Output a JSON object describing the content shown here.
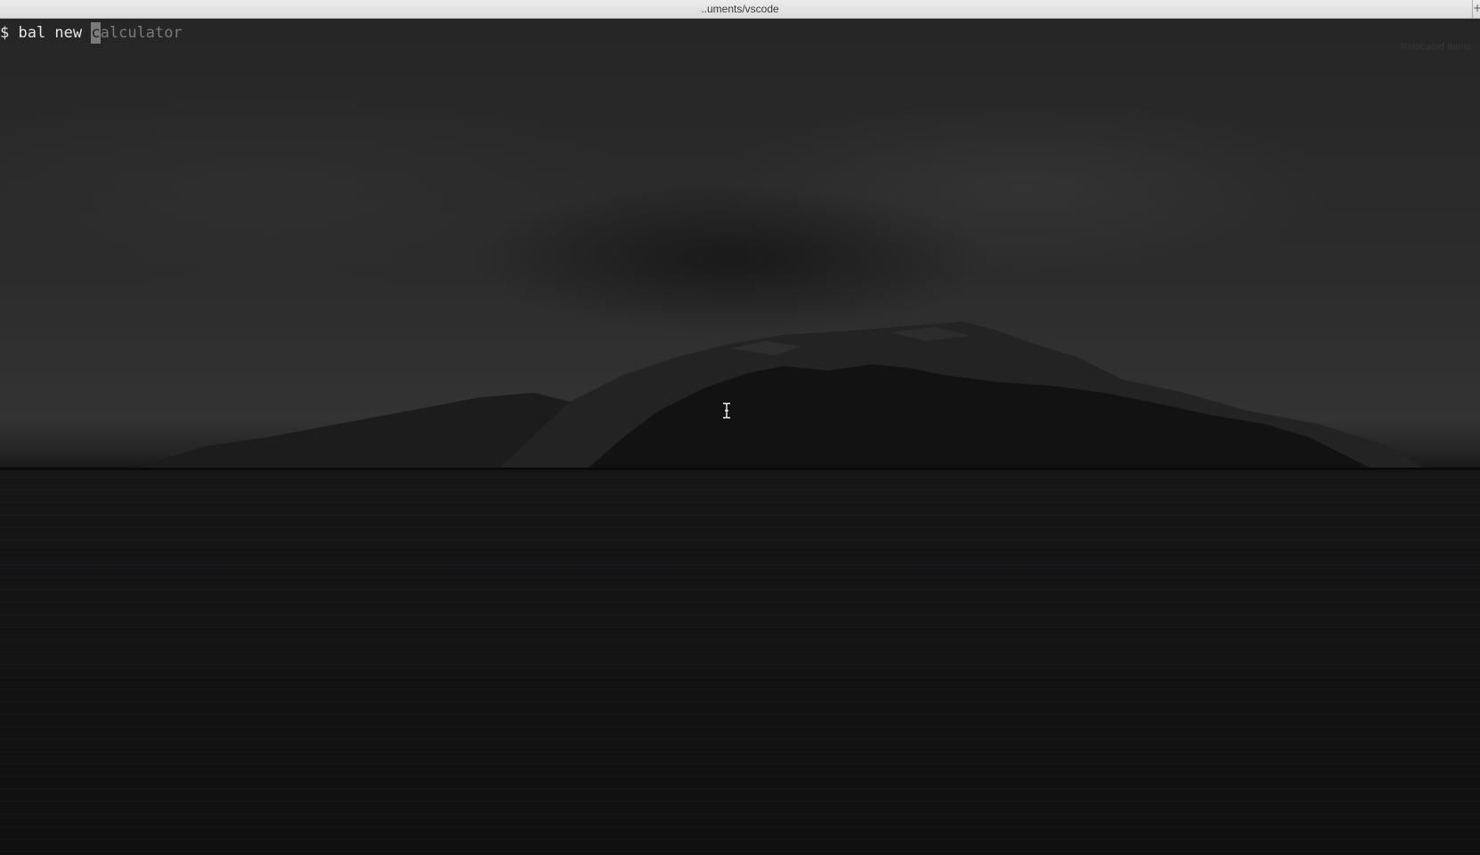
{
  "window": {
    "title": "..uments/vscode",
    "new_tab_glyph": "+"
  },
  "terminal": {
    "prompt": "$ ",
    "typed_text": "bal new ",
    "cursor_char": "c",
    "suggestion": "alculator"
  },
  "wallpaper": {
    "ghost_label": "Relocated Items"
  },
  "icons": {
    "mouse_cursor": "ibeam-cursor-icon"
  }
}
